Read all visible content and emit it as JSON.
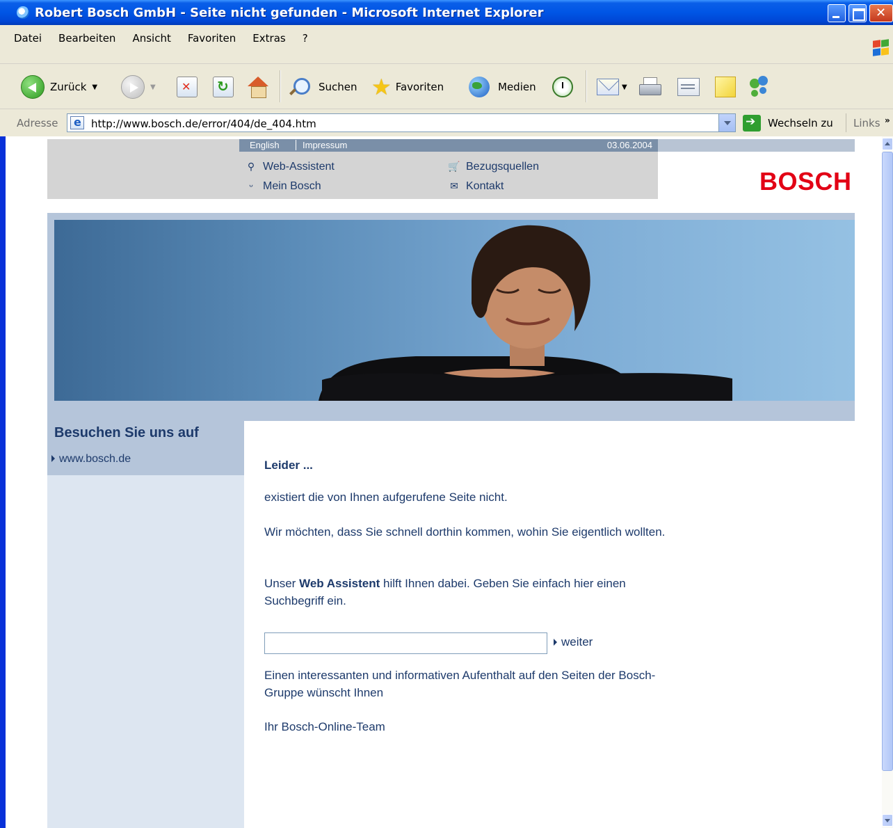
{
  "window": {
    "title": "Robert Bosch GmbH - Seite nicht gefunden - Microsoft Internet Explorer"
  },
  "menu": [
    "Datei",
    "Bearbeiten",
    "Ansicht",
    "Favoriten",
    "Extras",
    "?"
  ],
  "toolbar": {
    "back_label": "Zurück",
    "search_label": "Suchen",
    "favorites_label": "Favoriten",
    "media_label": "Medien"
  },
  "address": {
    "label": "Adresse",
    "url": "http://www.bosch.de/error/404/de_404.htm",
    "go_label": "Wechseln zu",
    "links_label": "Links"
  },
  "page": {
    "lang_english": "English",
    "lang_impressum": "Impressum",
    "date": "03.06.2004",
    "nav": {
      "web_assistent": "Web-Assistent",
      "mein_bosch": "Mein Bosch",
      "bezugsquellen": "Bezugsquellen",
      "kontakt": "Kontakt"
    },
    "logo": "BOSCH",
    "sidebar": {
      "title": "Besuchen Sie uns auf",
      "link": "www.bosch.de"
    },
    "content": {
      "heading": "Leider ...",
      "p1": "existiert die von Ihnen aufgerufene Seite nicht.",
      "p2": "Wir möchten, dass Sie schnell dorthin kommen, wohin Sie eigentlich wollten.",
      "p3_prefix": "Unser ",
      "p3_bold": "Web Assistent",
      "p3_suffix": " hilft Ihnen dabei. Geben Sie einfach hier einen Suchbegriff ein.",
      "search_value": "",
      "submit_label": "weiter",
      "p4": "Einen interessanten und informativen Aufenthalt auf den Seiten der Bosch-Gruppe wünscht Ihnen",
      "signature": "Ihr Bosch-Online-Team"
    }
  },
  "colors": {
    "titlebar": "#0055e5",
    "bosch_red": "#e20015",
    "text_navy": "#1d3a6b",
    "panel_blue": "#b5c5da"
  }
}
